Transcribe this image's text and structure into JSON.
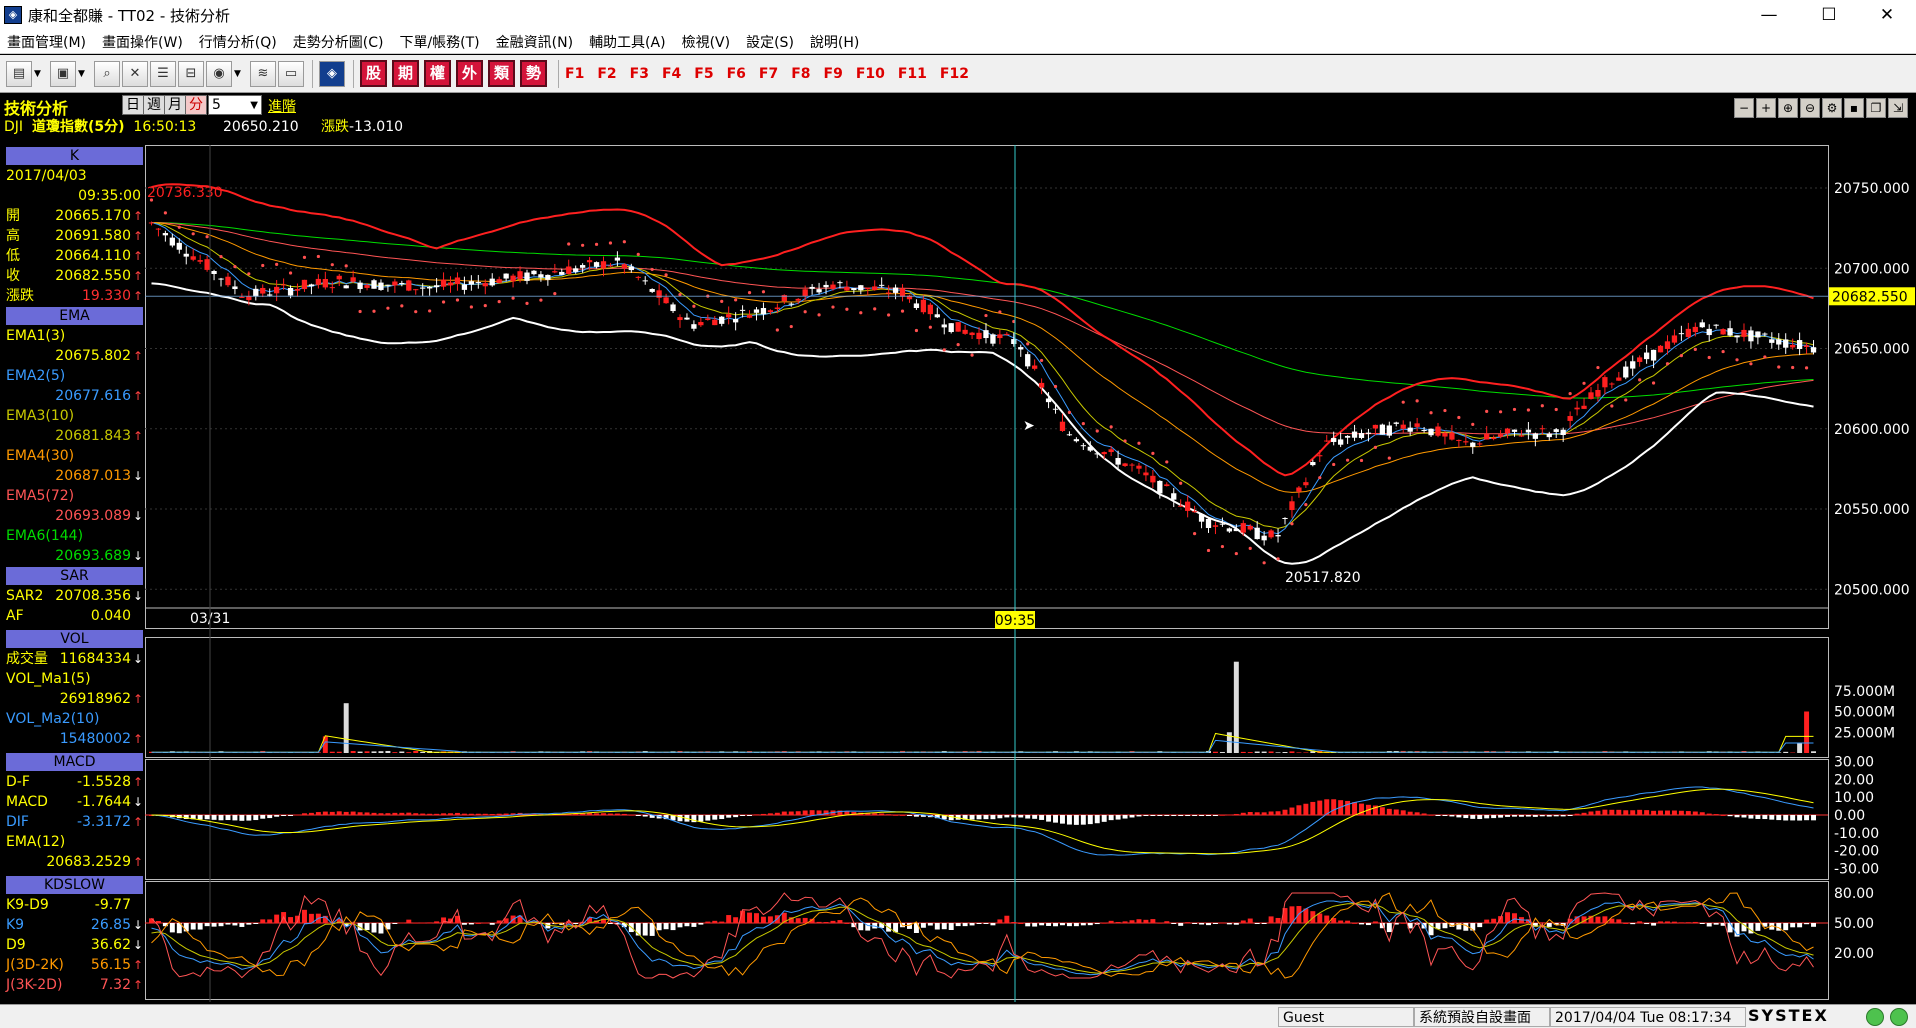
{
  "window": {
    "title": "康和全都賺 - TT02 - 技術分析",
    "minimize": "—",
    "maximize": "☐",
    "close": "✕"
  },
  "menu": [
    "畫面管理(M)",
    "畫面操作(W)",
    "行情分析(Q)",
    "走勢分析圖(C)",
    "下單/帳務(T)",
    "金融資訊(N)",
    "輔助工具(A)",
    "檢視(V)",
    "設定(S)",
    "說明(H)"
  ],
  "toolbar": {
    "icons": [
      "window-list-icon",
      "monitor-icon",
      "zoom-icon",
      "close-window-icon",
      "layout-icon",
      "split-icon",
      "globe-icon",
      "layers-icon",
      "screen-icon",
      "logo-icon"
    ],
    "quick_buttons": [
      "股",
      "期",
      "權",
      "外",
      "類",
      "勢"
    ],
    "fkeys": [
      "F1",
      "F2",
      "F3",
      "F4",
      "F5",
      "F6",
      "F7",
      "F8",
      "F9",
      "F10",
      "F11",
      "F12"
    ]
  },
  "info": {
    "panel_title": "技術分析",
    "periods": [
      "日",
      "週",
      "月",
      "分"
    ],
    "active_period": "分",
    "interval": "5",
    "next_label": "進階",
    "symbol": "DJI",
    "name": "道瓊指數(5分)",
    "time": "16:50:13",
    "price": "20650.210",
    "change_label": "漲跌",
    "change": "-13.010"
  },
  "panel_controls": [
    "−",
    "+",
    "zoom-in",
    "zoom-out",
    "settings",
    "save",
    "restore",
    "export"
  ],
  "left": {
    "k": {
      "header": "K",
      "date": "2017/04/03",
      "time": "09:35:00",
      "rows": [
        {
          "label": "開",
          "value": "20665.170",
          "dir": "up"
        },
        {
          "label": "高",
          "value": "20691.580",
          "dir": "up"
        },
        {
          "label": "低",
          "value": "20664.110",
          "dir": "up"
        },
        {
          "label": "收",
          "value": "20682.550",
          "dir": "up"
        },
        {
          "label": "漲跌",
          "value": "19.330",
          "dir": "up"
        }
      ]
    },
    "ema": {
      "header": "EMA",
      "rows": [
        {
          "label": "EMA1(3)",
          "value": "20675.802",
          "dir": "up",
          "color": "#ffff00"
        },
        {
          "label": "EMA2(5)",
          "value": "20677.616",
          "dir": "up",
          "color": "#3a9bff"
        },
        {
          "label": "EMA3(10)",
          "value": "20681.843",
          "dir": "up",
          "color": "#c8c800"
        },
        {
          "label": "EMA4(30)",
          "value": "20687.013",
          "dir": "dn",
          "color": "#ff9900"
        },
        {
          "label": "EMA5(72)",
          "value": "20693.089",
          "dir": "dn",
          "color": "#ff5555"
        },
        {
          "label": "EMA6(144)",
          "value": "20693.689",
          "dir": "dn",
          "color": "#00dd00"
        }
      ]
    },
    "sar": {
      "header": "SAR",
      "rows": [
        {
          "label": "SAR2",
          "value": "20708.356",
          "dir": "dn"
        },
        {
          "label": "AF",
          "value": "0.040",
          "dir": ""
        }
      ]
    },
    "vol": {
      "header": "VOL",
      "rows": [
        {
          "label": "成交量",
          "value": "11684334",
          "dir": "dn",
          "color": "#ffff00"
        },
        {
          "label": "VOL_Ma1(5)",
          "value": "",
          "dir": "",
          "color": "#ffff00"
        },
        {
          "label": "",
          "value": "26918962",
          "dir": "up",
          "color": "#ffff00"
        },
        {
          "label": "VOL_Ma2(10)",
          "value": "",
          "dir": "",
          "color": "#3a9bff"
        },
        {
          "label": "",
          "value": "15480002",
          "dir": "up",
          "color": "#3a9bff"
        }
      ]
    },
    "macd": {
      "header": "MACD",
      "rows": [
        {
          "label": "D-F",
          "value": "-1.5528",
          "dir": "up"
        },
        {
          "label": "MACD",
          "value": "-1.7644",
          "dir": "dn"
        },
        {
          "label": "DIF",
          "value": "-3.3172",
          "dir": "up",
          "color": "#3a9bff"
        },
        {
          "label": "EMA(12)",
          "value": "",
          "dir": ""
        },
        {
          "label": "",
          "value": "20683.2529",
          "dir": "up"
        }
      ]
    },
    "kd": {
      "header": "KDSLOW",
      "rows": [
        {
          "label": "K9-D9",
          "value": "-9.77",
          "dir": ""
        },
        {
          "label": "K9",
          "value": "26.85",
          "dir": "dn",
          "color": "#3a9bff"
        },
        {
          "label": "D9",
          "value": "36.62",
          "dir": "dn"
        },
        {
          "label": "J(3D-2K)",
          "value": "56.15",
          "dir": "up",
          "color": "#ff9900"
        },
        {
          "label": "J(3K-2D)",
          "value": "7.32",
          "dir": "up",
          "color": "#ff5555"
        }
      ]
    }
  },
  "price_chart": {
    "y_ticks": [
      "20750.000",
      "20700.000",
      "20650.000",
      "20600.000",
      "20550.000",
      "20500.000"
    ],
    "last_price_label": "20682.550",
    "hi_label": "20736.330",
    "lo_label": "20517.820",
    "date_label": "03/31",
    "cursor_label": "09:35"
  },
  "vol_chart": {
    "y_ticks": [
      "75.000M",
      "50.000M",
      "25.000M"
    ]
  },
  "macd_chart": {
    "y_ticks": [
      "30.00",
      "20.00",
      "10.00",
      "0.00",
      "-10.00",
      "-20.00",
      "-30.00"
    ]
  },
  "kd_chart": {
    "y_ticks": [
      "80.00",
      "50.00",
      "20.00"
    ]
  },
  "status": {
    "user": "Guest",
    "screen": "系統預設自設畫面",
    "datetime": "2017/04/04 Tue 08:17:34",
    "brand": "SYSTEX"
  },
  "colors": {
    "up": "#ff2020",
    "down": "#ffffff",
    "ema1": "#ffff00",
    "ema2": "#3a9bff",
    "ema3": "#c8c800",
    "ema4": "#ff9900",
    "ema5": "#ff5555",
    "ema6": "#00dd00",
    "boll": "#ff2020",
    "grid": "#404040"
  }
}
